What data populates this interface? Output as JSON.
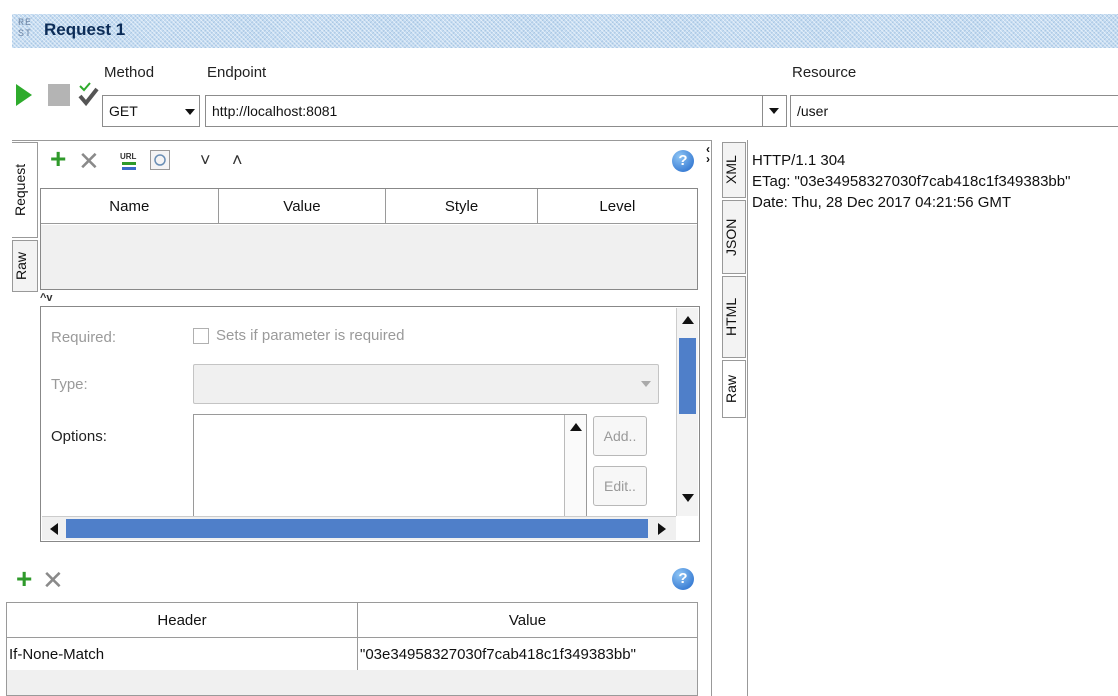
{
  "title_bar": {
    "icon_text": "RE\nST",
    "title": "Request 1"
  },
  "request_bar": {
    "method_label": "Method",
    "method_value": "GET",
    "endpoint_label": "Endpoint",
    "endpoint_value": "http://localhost:8081",
    "resource_label": "Resource",
    "resource_value": "/user"
  },
  "left_tabs": {
    "request": "Request",
    "raw": "Raw"
  },
  "params_table": {
    "columns": [
      "Name",
      "Value",
      "Style",
      "Level"
    ]
  },
  "param_detail": {
    "required_label": "Required:",
    "required_checkbox_label": "Sets if parameter is required",
    "type_label": "Type:",
    "options_label": "Options:",
    "add_button": "Add..",
    "edit_button": "Edit.."
  },
  "headers_table": {
    "columns": [
      "Header",
      "Value"
    ],
    "rows": [
      {
        "header": "If-None-Match",
        "value": "\"03e34958327030f7cab418c1f349383bb\""
      }
    ]
  },
  "response_tabs": {
    "xml": "XML",
    "json": "JSON",
    "html": "HTML",
    "raw": "Raw"
  },
  "response_raw": {
    "lines": [
      "HTTP/1.1 304",
      "ETag: \"03e34958327030f7cab418c1f349383bb\"",
      "Date: Thu, 28 Dec 2017 04:21:56 GMT"
    ]
  },
  "icons": {
    "help": "?",
    "add": "+",
    "remove": "✕",
    "chevron_down": "˅",
    "chevron_up": "˄"
  }
}
